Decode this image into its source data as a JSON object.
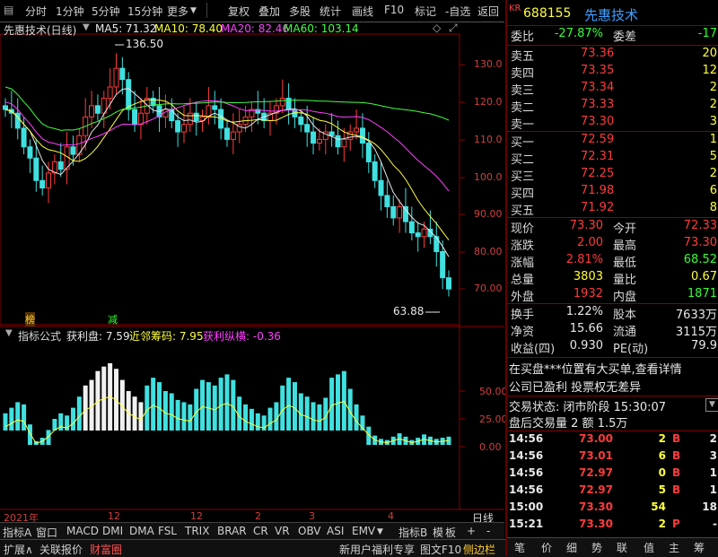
{
  "toolbar": {
    "tabs": [
      "分时",
      "1分钟",
      "5分钟",
      "15分钟",
      "更多"
    ],
    "actions": [
      "复权",
      "叠加",
      "多股",
      "统计",
      "画线",
      "F10",
      "标记",
      "-自选",
      "返回"
    ]
  },
  "chart": {
    "title": "先惠技术(日线)",
    "ma5": "MA5: 71.32",
    "ma10": "MA10: 78.40",
    "ma20": "MA20: 82.46",
    "ma60": "MA60: 103.14",
    "high_label": "136.50",
    "low_label": "63.88",
    "y_ticks": [
      "130.0",
      "120.0",
      "110.0",
      "100.0",
      "90.00",
      "80.00",
      "70.00"
    ],
    "marker_bang": "榜",
    "marker_jian": "减",
    "indicator_name": "指标公式",
    "ind_a": "获利盘: 7.59",
    "ind_b": "近邻筹码: 7.95",
    "ind_c": "获利纵横: -0.36",
    "ind_ticks": [
      "50.00",
      "25.00",
      "0.00"
    ],
    "date_labels": [
      "2021年",
      "12",
      "2",
      "3",
      "4"
    ],
    "period_label": "日线"
  },
  "chart_data": {
    "type": "candlestick",
    "title": "先惠技术(日线)",
    "ylim": [
      63.88,
      136.5
    ],
    "closes": [
      118,
      117,
      113,
      108,
      105,
      99,
      97,
      101,
      104,
      102,
      108,
      106,
      111,
      116,
      119,
      117,
      121,
      124,
      129,
      126,
      118,
      114,
      117,
      121,
      119,
      116,
      118,
      115,
      112,
      114,
      117,
      115,
      116,
      119,
      118,
      113,
      110,
      112,
      114,
      116,
      118,
      117,
      115,
      117,
      119,
      121,
      118,
      116,
      114,
      112,
      109,
      110,
      112,
      111,
      108,
      110,
      112,
      113,
      109,
      104,
      99,
      95,
      92,
      89,
      92,
      88,
      85,
      84,
      86,
      84,
      80,
      73,
      70
    ]
  },
  "indicator_chart": {
    "type": "bar",
    "values": [
      30,
      35,
      40,
      38,
      20,
      5,
      8,
      15,
      25,
      30,
      28,
      35,
      45,
      55,
      60,
      68,
      72,
      75,
      70,
      60,
      50,
      45,
      40,
      55,
      62,
      58,
      50,
      48,
      42,
      40,
      38,
      52,
      60,
      58,
      55,
      62,
      65,
      60,
      45,
      38,
      34,
      30,
      28,
      35,
      40,
      55,
      62,
      58,
      48,
      45,
      40,
      38,
      44,
      62,
      65,
      68,
      52,
      38,
      28,
      18,
      10,
      7,
      6,
      9,
      12,
      9,
      6,
      8,
      11,
      9,
      7,
      8,
      9
    ]
  },
  "panel": {
    "code_prefix": "KR",
    "code": "688155",
    "name": "先惠技术",
    "weibi_label": "委比",
    "weibi": "-27.87%",
    "weicha_label": "委差",
    "weicha": "-17",
    "asks": [
      {
        "label": "卖五",
        "price": "73.36",
        "vol": "20"
      },
      {
        "label": "卖四",
        "price": "73.35",
        "vol": "12"
      },
      {
        "label": "卖三",
        "price": "73.34",
        "vol": "2"
      },
      {
        "label": "卖二",
        "price": "73.33",
        "vol": "2"
      },
      {
        "label": "卖一",
        "price": "73.30",
        "vol": "3"
      }
    ],
    "bids": [
      {
        "label": "买一",
        "price": "72.59",
        "vol": "1"
      },
      {
        "label": "买二",
        "price": "72.31",
        "vol": "5"
      },
      {
        "label": "买三",
        "price": "72.25",
        "vol": "2"
      },
      {
        "label": "买四",
        "price": "71.98",
        "vol": "6"
      },
      {
        "label": "买五",
        "price": "71.92",
        "vol": "8"
      }
    ],
    "quote": [
      {
        "l1": "现价",
        "v1": "73.30",
        "c1": "red",
        "l2": "今开",
        "v2": "72.33",
        "c2": "red"
      },
      {
        "l1": "涨跌",
        "v1": "2.00",
        "c1": "red",
        "l2": "最高",
        "v2": "73.30",
        "c2": "red"
      },
      {
        "l1": "涨幅",
        "v1": "2.81%",
        "c1": "red",
        "l2": "最低",
        "v2": "68.52",
        "c2": "green"
      },
      {
        "l1": "总量",
        "v1": "3803",
        "c1": "yellow",
        "l2": "量比",
        "v2": "0.67",
        "c2": "yellow"
      },
      {
        "l1": "外盘",
        "v1": "1932",
        "c1": "red",
        "l2": "内盘",
        "v2": "1871",
        "c2": "green"
      }
    ],
    "fin": [
      {
        "l1": "换手",
        "v1": "1.22%",
        "l2": "股本",
        "v2": "7633万"
      },
      {
        "l1": "净资",
        "v1": "15.66",
        "l2": "流通",
        "v2": "3115万"
      },
      {
        "l1": "收益(四)",
        "v1": "0.930",
        "l2": "PE(动)",
        "v2": "79.9"
      }
    ],
    "news1": "在买盘***位置有大买单,查看详情",
    "news2": "公司已盈利 投票权无差异",
    "status": "交易状态: 闭市阶段 15:30:07",
    "after": "盘后交易量 2 额 1.5万",
    "ticks": [
      {
        "time": "14:56",
        "price": "73.00",
        "vol": "2",
        "bs": "B",
        "n": "2"
      },
      {
        "time": "14:56",
        "price": "73.01",
        "vol": "6",
        "bs": "B",
        "n": "3"
      },
      {
        "time": "14:56",
        "price": "72.97",
        "vol": "0",
        "bs": "B",
        "n": "1"
      },
      {
        "time": "14:56",
        "price": "72.97",
        "vol": "5",
        "bs": "B",
        "n": "1"
      },
      {
        "time": "15:00",
        "price": "73.30",
        "vol": "54",
        "bs": "",
        "n": "18"
      },
      {
        "time": "15:21",
        "price": "73.30",
        "vol": "2",
        "bs": "P",
        "n": "-"
      }
    ]
  },
  "bottom": {
    "tabs1": [
      "指标A",
      "窗口",
      "MACD",
      "DMI",
      "DMA",
      "FSL",
      "TRIX",
      "BRAR",
      "CR",
      "VR",
      "OBV",
      "ASI",
      "EMV"
    ],
    "tabs1_right": [
      "指标B",
      "模",
      "板",
      "+",
      "-"
    ],
    "tabs2": [
      "扩展∧",
      "关联报价",
      "财富圈"
    ],
    "tabs2_right": [
      "新用户福利专享",
      "图文F10",
      "侧边栏"
    ],
    "panel_tabs": [
      "笔",
      "价",
      "细",
      "势",
      "联",
      "值",
      "主",
      "筹"
    ]
  }
}
